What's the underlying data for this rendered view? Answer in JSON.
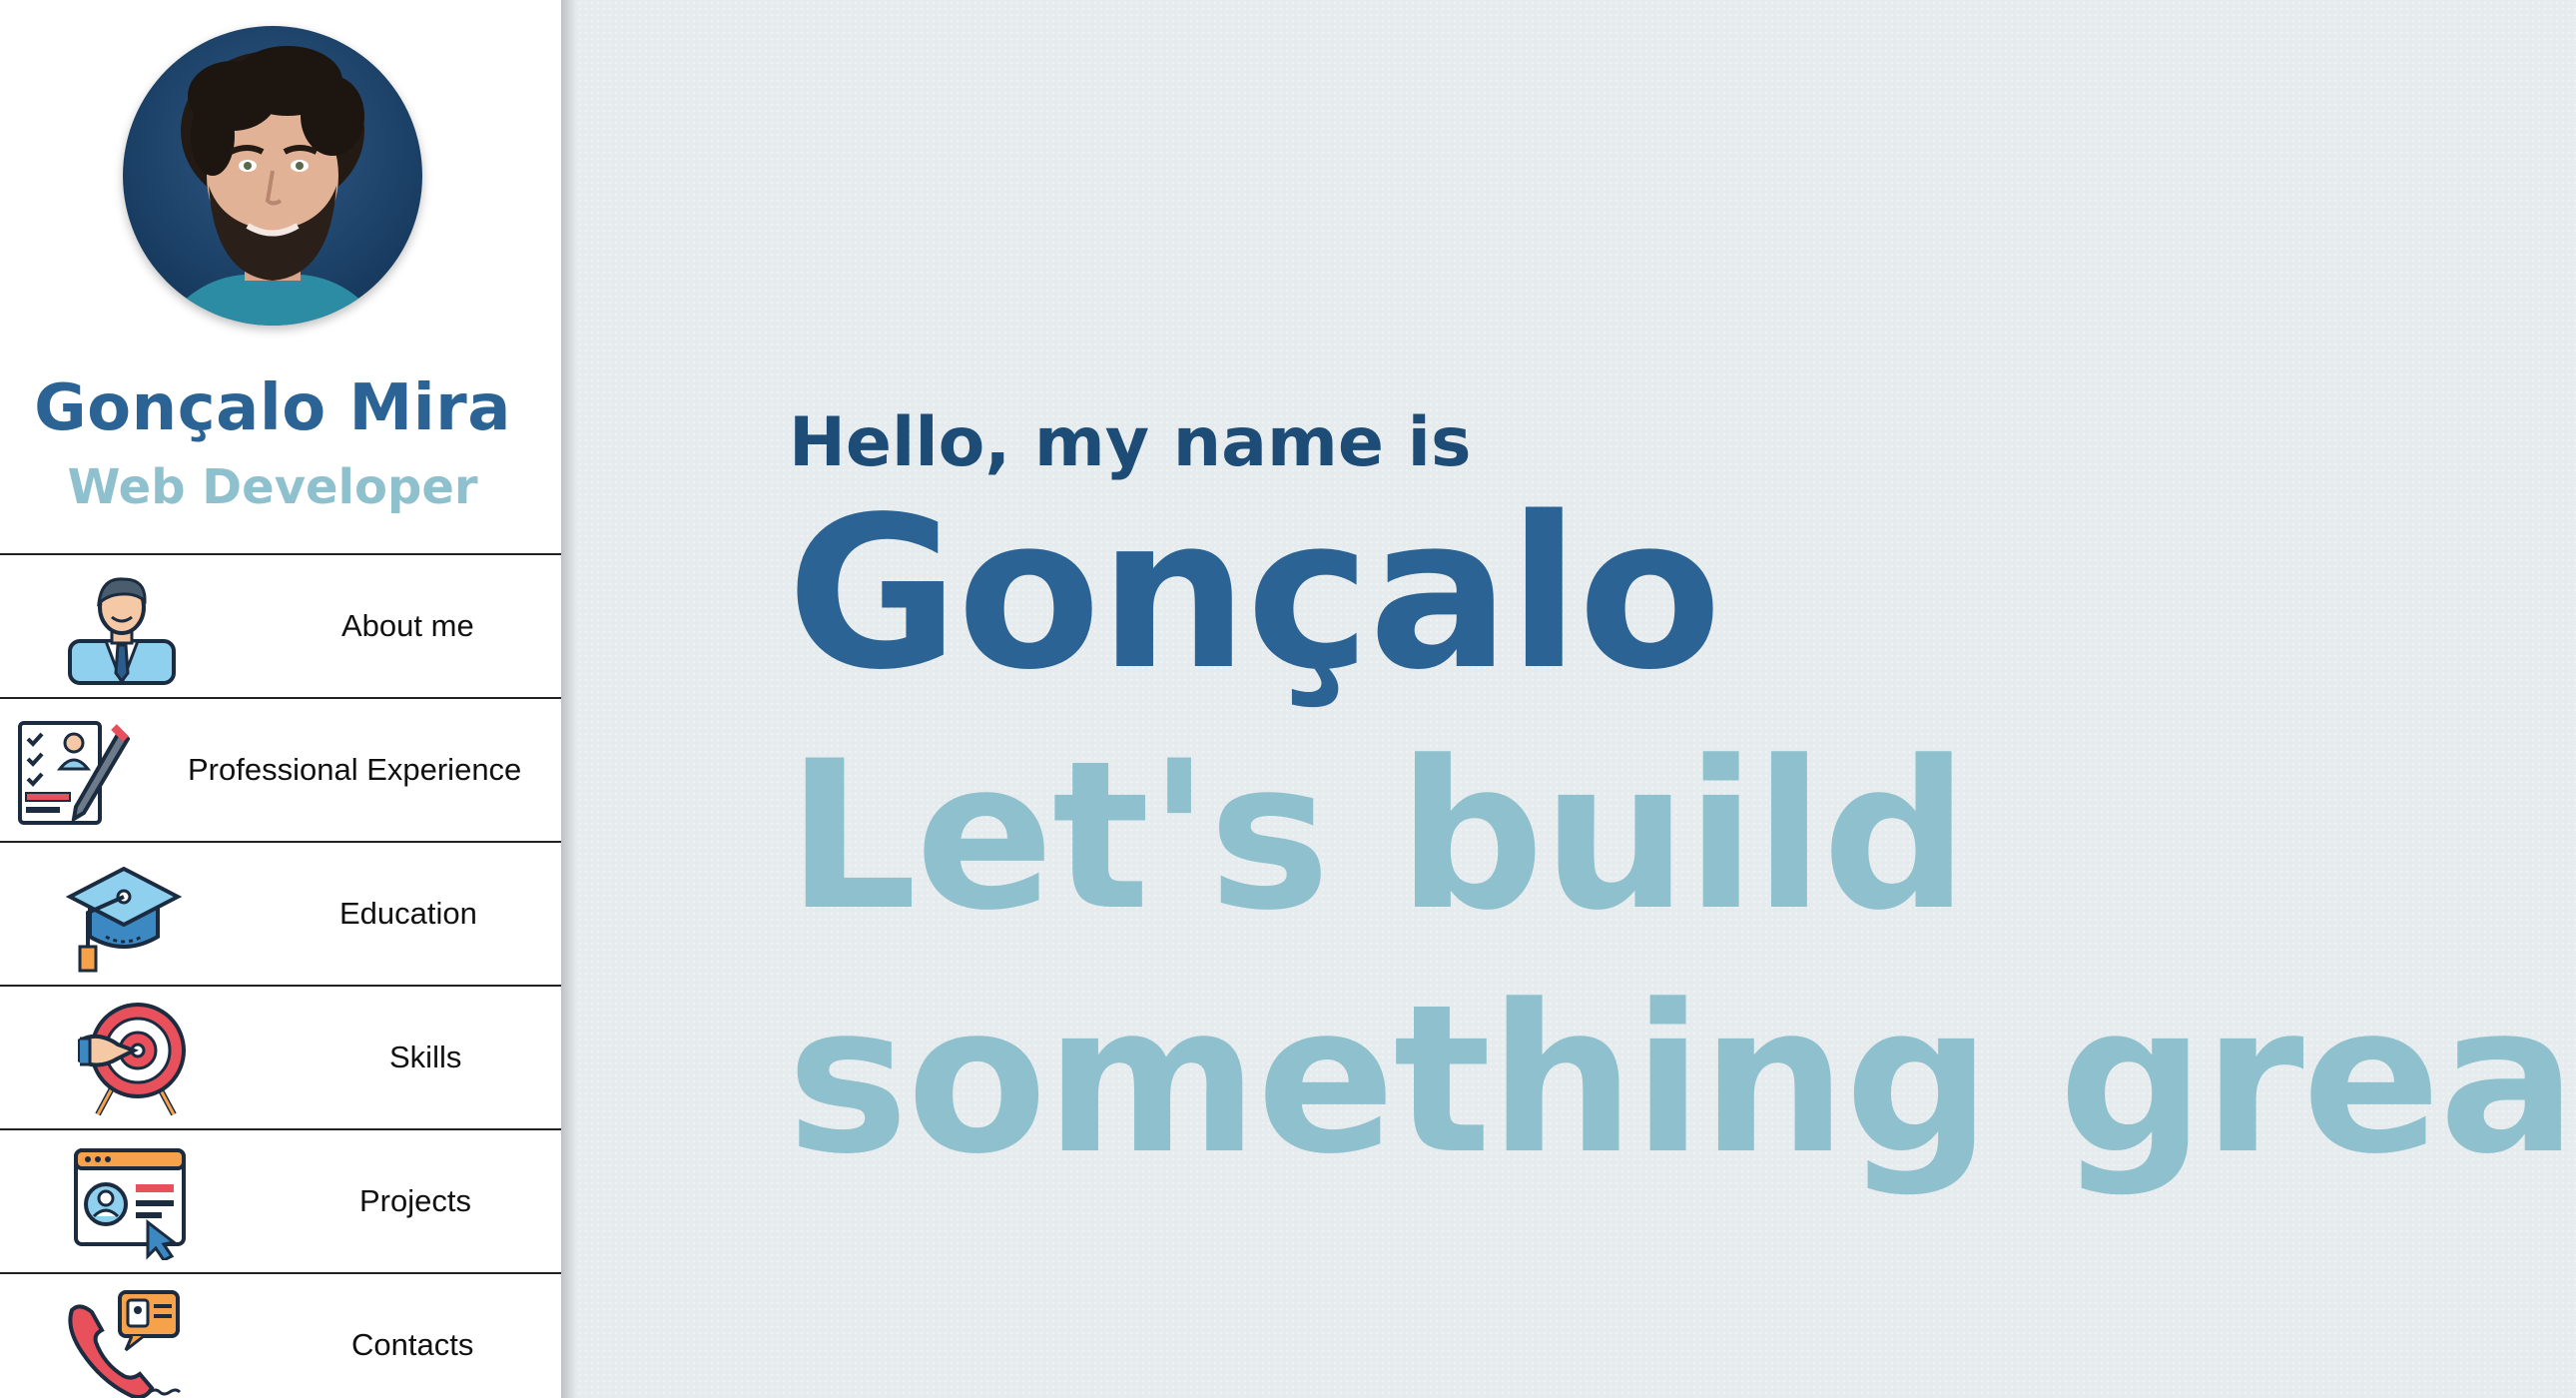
{
  "profile": {
    "name": "Gonçalo Mira",
    "role": "Web Developer"
  },
  "nav": {
    "items": [
      {
        "label": "About me",
        "icon": "businessman-icon"
      },
      {
        "label": "Professional Experience",
        "icon": "resume-pencil-icon"
      },
      {
        "label": "Education",
        "icon": "graduation-cap-icon"
      },
      {
        "label": "Skills",
        "icon": "target-icon"
      },
      {
        "label": "Projects",
        "icon": "web-profile-icon"
      },
      {
        "label": "Contacts",
        "icon": "phone-contact-icon"
      }
    ]
  },
  "hero": {
    "greeting": "Hello, my name is",
    "first_name": "Gonçalo",
    "tagline_line1": "Let's build",
    "tagline_line2": "something great"
  },
  "colors": {
    "primary": "#2b6494",
    "dark": "#1d4c76",
    "accent": "#8ec0cd",
    "background": "#e6ebee"
  }
}
